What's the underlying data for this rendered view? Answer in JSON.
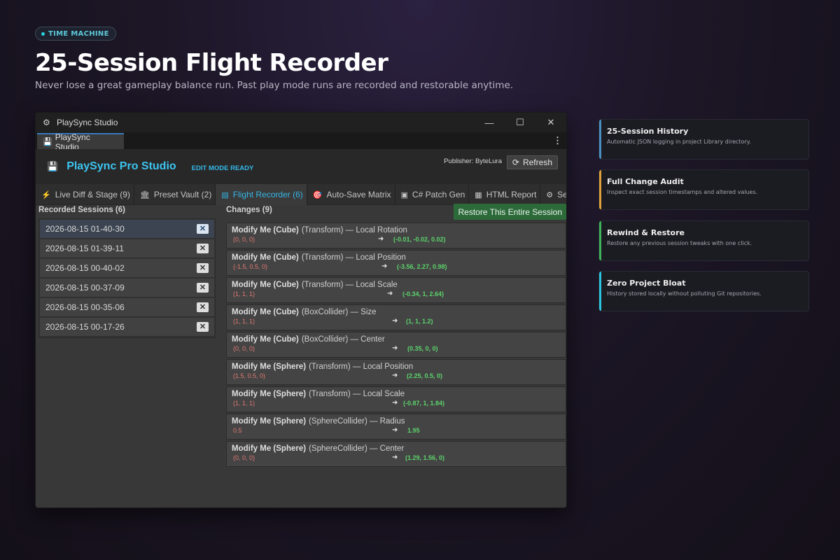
{
  "badge": {
    "label": "TIME MACHINE"
  },
  "hero": {
    "title": "25-Session Flight Recorder",
    "subtitle": "Never lose a great gameplay balance run. Past play mode runs are recorded and restorable anytime."
  },
  "window": {
    "title": "PlaySync Studio",
    "tab_label": "PlaySync Studio",
    "controls": {
      "minimize": "—",
      "maximize": "☐",
      "close": "✕"
    }
  },
  "app": {
    "name": "PlaySync Pro Studio",
    "mode": "EDIT MODE READY",
    "publisher": "Publisher: ByteLura",
    "refresh_label": "Refresh"
  },
  "tabs": [
    {
      "icon": "⚡",
      "label": "Live Diff & Stage (9)"
    },
    {
      "icon": "🏛",
      "label": "Preset Vault (2)"
    },
    {
      "icon": "▤",
      "label": "Flight Recorder (6)",
      "active": true
    },
    {
      "icon": "🎯",
      "label": "Auto-Save Matrix"
    },
    {
      "icon": "▣",
      "label": "C# Patch Gen"
    },
    {
      "icon": "▦",
      "label": "HTML Report"
    },
    {
      "icon": "⚙",
      "label": "Settings"
    }
  ],
  "sessions": {
    "title": "Recorded Sessions (6)",
    "items": [
      {
        "label": "2026-08-15 01-40-30",
        "selected": true
      },
      {
        "label": "2026-08-15 01-39-11"
      },
      {
        "label": "2026-08-15 00-40-02"
      },
      {
        "label": "2026-08-15 00-37-09"
      },
      {
        "label": "2026-08-15 00-35-06"
      },
      {
        "label": "2026-08-15 00-17-26"
      }
    ]
  },
  "changes": {
    "title": "Changes (9)",
    "restore_label": "Restore This Entire Session",
    "items": [
      {
        "object": "Modify Me (Cube)",
        "detail": "(Transform) — Local Rotation",
        "old": "(0, 0, 0)",
        "new": "(-0.01, -0.02, 0.02)"
      },
      {
        "object": "Modify Me (Cube)",
        "detail": "(Transform) — Local Position",
        "old": "(-1.5, 0.5, 0)",
        "new": "(-3.56, 2.27, 0.98)"
      },
      {
        "object": "Modify Me (Cube)",
        "detail": "(Transform) — Local Scale",
        "old": "(1, 1, 1)",
        "new": "(-0.34, 1, 2.64)"
      },
      {
        "object": "Modify Me (Cube)",
        "detail": "(BoxCollider) — Size",
        "old": "(1, 1, 1)",
        "new": "(1, 1, 1.2)"
      },
      {
        "object": "Modify Me (Cube)",
        "detail": "(BoxCollider) — Center",
        "old": "(0, 0, 0)",
        "new": "(0.35, 0, 0)"
      },
      {
        "object": "Modify Me (Sphere)",
        "detail": "(Transform) — Local Position",
        "old": "(1.5, 0.5, 0)",
        "new": "(2.25, 0.5, 0)"
      },
      {
        "object": "Modify Me (Sphere)",
        "detail": "(Transform) — Local Scale",
        "old": "(1, 1, 1)",
        "new": "(-0.87, 1, 1.84)"
      },
      {
        "object": "Modify Me (Sphere)",
        "detail": "(SphereCollider) — Radius",
        "old": "0.5",
        "new": "1.95"
      },
      {
        "object": "Modify Me (Sphere)",
        "detail": "(SphereCollider) — Center",
        "old": "(0, 0, 0)",
        "new": "(1.29, 1.56, 0)"
      }
    ]
  },
  "features": [
    {
      "title": "25-Session History",
      "desc": "Automatic JSON logging in project Library directory.",
      "color": "#4a90c2"
    },
    {
      "title": "Full Change Audit",
      "desc": "Inspect exact session timestamps and altered values.",
      "color": "#e0a23a"
    },
    {
      "title": "Rewind & Restore",
      "desc": "Restore any previous session tweaks with one click.",
      "color": "#3fb45c"
    },
    {
      "title": "Zero Project Bloat",
      "desc": "History stored locally without polluting Git repositories.",
      "color": "#2ac6e0"
    }
  ],
  "colors": {
    "accent": "#3cc3f0",
    "old_value": "#e07a74",
    "new_value": "#5bd36b",
    "restore_button": "#2d6a3a"
  }
}
